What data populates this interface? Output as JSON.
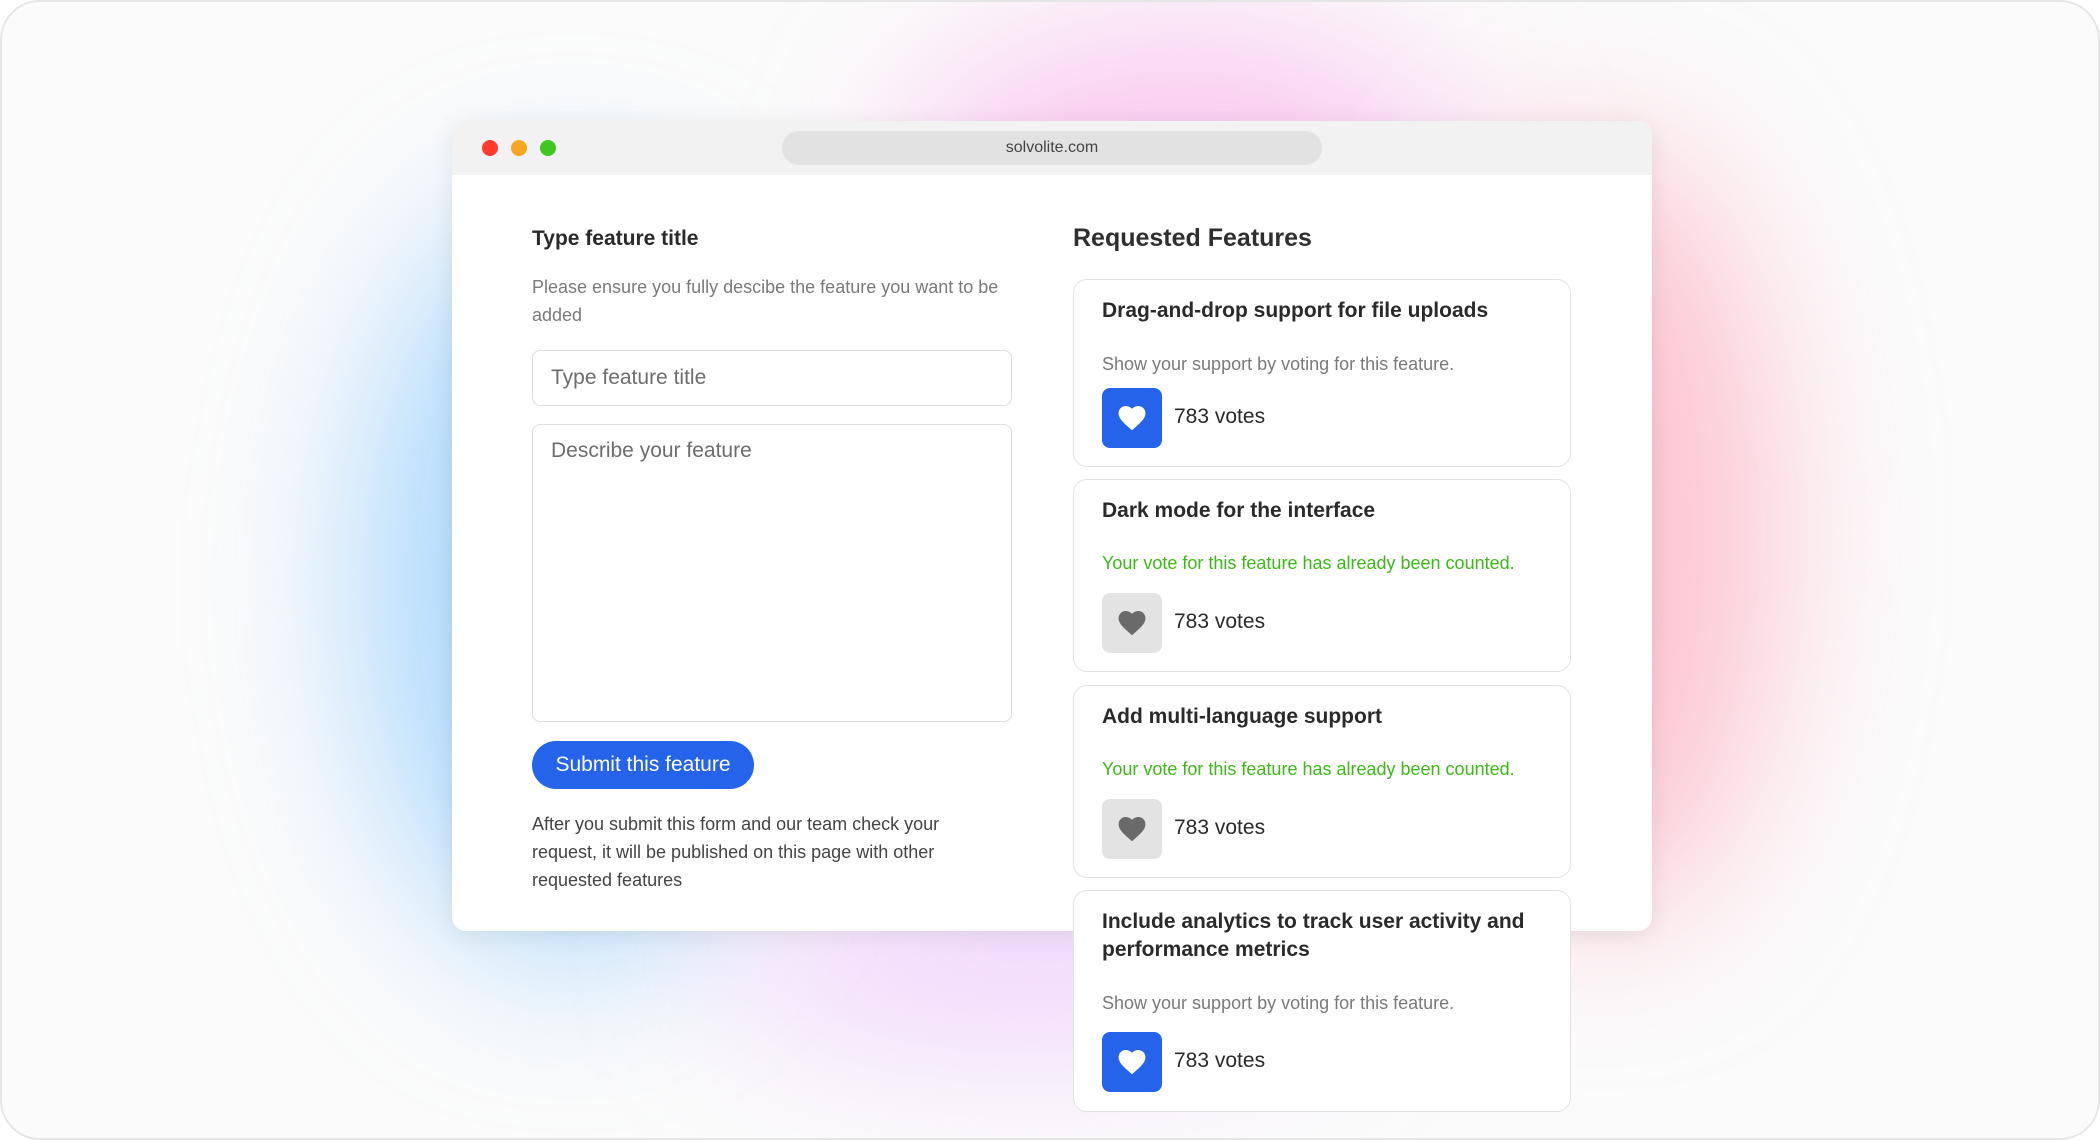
{
  "browser": {
    "url": "solvolite.com"
  },
  "form": {
    "title": "Type feature title",
    "help_text": "Please ensure you fully descibe the feature you want to be added",
    "title_placeholder": "Type feature title",
    "description_placeholder": "Describe your feature",
    "submit_label": "Submit this feature",
    "after_note": "After  you submit this form and our team check your request, it will be published on this page with other requested features"
  },
  "features": {
    "heading": "Requested Features",
    "items": [
      {
        "title": "Drag-and-drop support for file uploads",
        "message": "Show your support by voting for this feature.",
        "votes": "783 votes",
        "state": "active"
      },
      {
        "title": "Dark mode for the interface",
        "message": "Your vote for this feature has already been counted.",
        "votes": "783 votes",
        "state": "voted"
      },
      {
        "title": "Add multi-language support",
        "message": "Your vote for this feature has already been counted.",
        "votes": "783 votes",
        "state": "voted"
      },
      {
        "title": "Include analytics to track user activity and performance metrics",
        "message": "Show your support by voting for this feature.",
        "votes": "783 votes",
        "state": "active"
      }
    ]
  },
  "colors": {
    "accent": "#2563eb",
    "counted": "#3cb818",
    "voted_bg": "#e3e3e3"
  },
  "icons": {
    "vote": "heart-icon"
  }
}
